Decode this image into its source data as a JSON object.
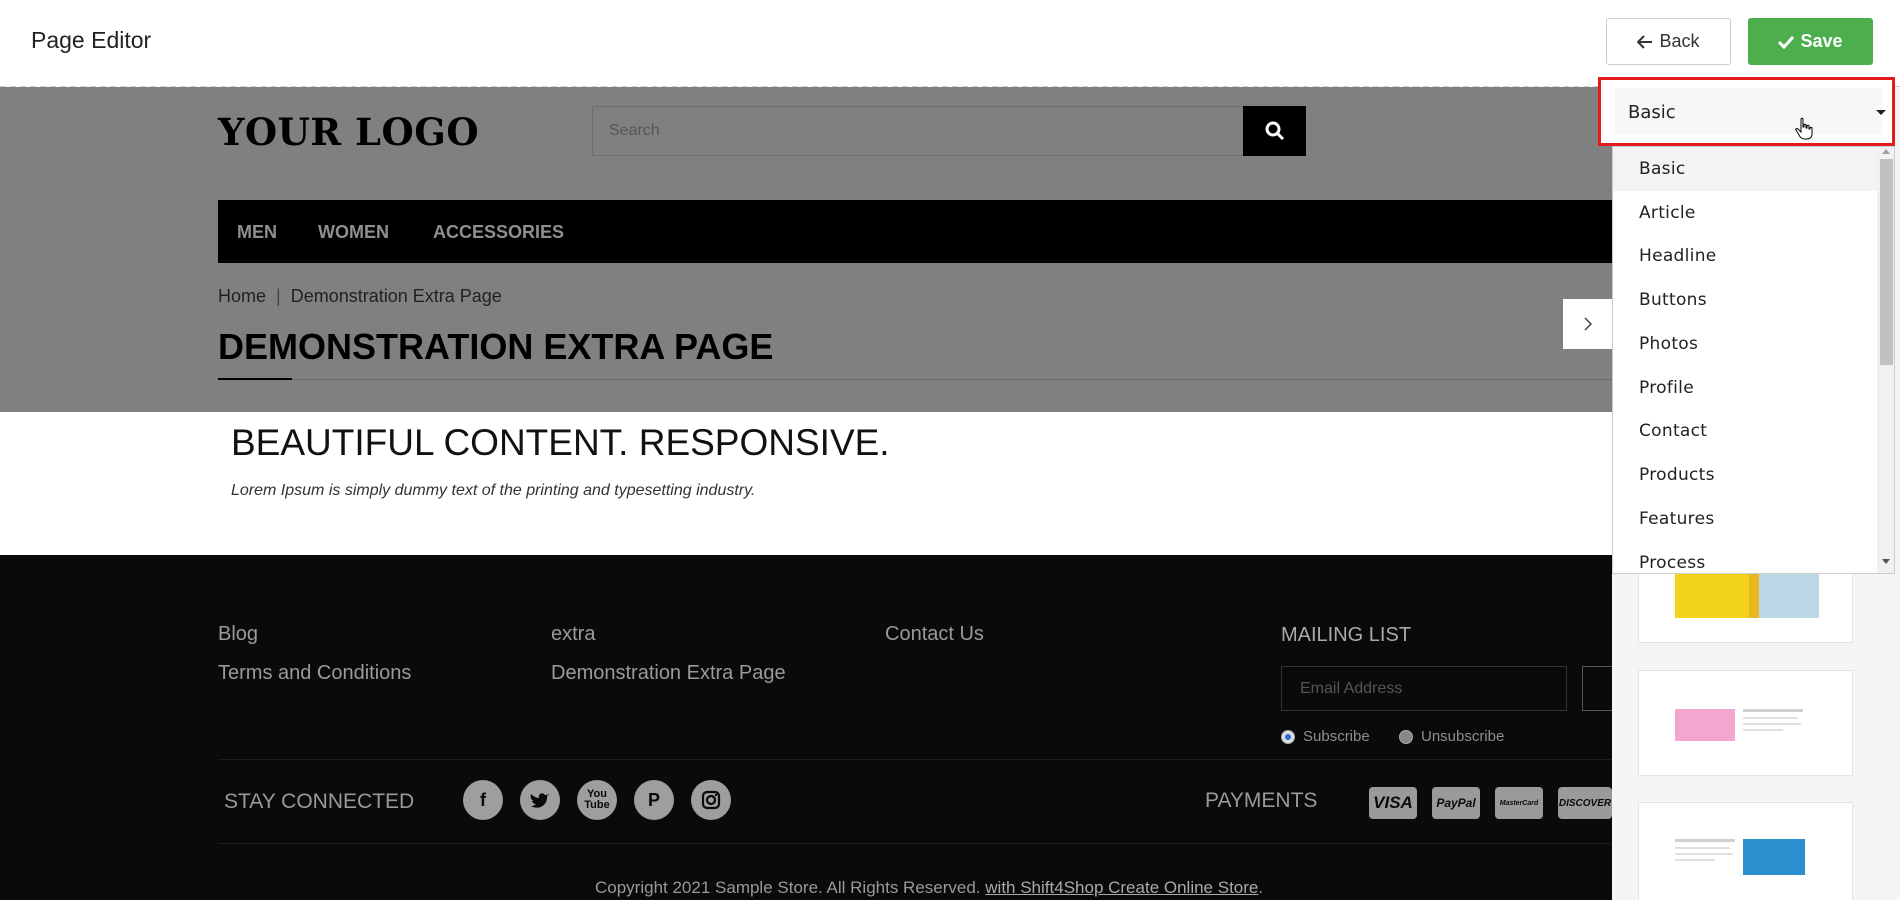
{
  "editor": {
    "title": "Page Editor",
    "back_label": "Back",
    "save_label": "Save"
  },
  "store": {
    "logo": "YOUR LOGO",
    "search_placeholder": "Search",
    "nav": [
      "MEN",
      "WOMEN",
      "ACCESSORIES"
    ],
    "breadcrumb": {
      "home": "Home",
      "separator": "|",
      "current": "Demonstration Extra Page"
    },
    "page_heading": "DEMONSTRATION EXTRA PAGE"
  },
  "content": {
    "title": "BEAUTIFUL CONTENT. RESPONSIVE.",
    "text": "Lorem Ipsum is simply dummy text of the printing and typesetting industry."
  },
  "footer": {
    "links": {
      "blog": "Blog",
      "terms": "Terms and Conditions",
      "extra": "extra",
      "demo": "Demonstration Extra Page",
      "contact": "Contact Us"
    },
    "mailing_title": "MAILING LIST",
    "email_placeholder": "Email Address",
    "subscribe": "Subscribe",
    "unsubscribe": "Unsubscribe",
    "stay_connected": "STAY CONNECTED",
    "social": [
      "facebook-icon",
      "twitter-icon",
      "youtube-icon",
      "pinterest-icon",
      "instagram-icon"
    ],
    "payments_label": "PAYMENTS",
    "payment_cards": [
      "VISA",
      "PayPal",
      "MasterCard",
      "DISCOVER"
    ],
    "copyright_text": "Copyright 2021 Sample Store. All Rights Reserved.",
    "copyright_link": "with Shift4Shop Create Online Store",
    "copyright_end": "."
  },
  "dropdown": {
    "selected": "Basic",
    "options": [
      "Basic",
      "Article",
      "Headline",
      "Buttons",
      "Photos",
      "Profile",
      "Contact",
      "Products",
      "Features",
      "Process"
    ]
  },
  "colors": {
    "save_button": "#4cae4c",
    "highlight_border": "#e31b1b",
    "footer_bg": "#0a0a0a",
    "nav_bg": "#000000"
  }
}
